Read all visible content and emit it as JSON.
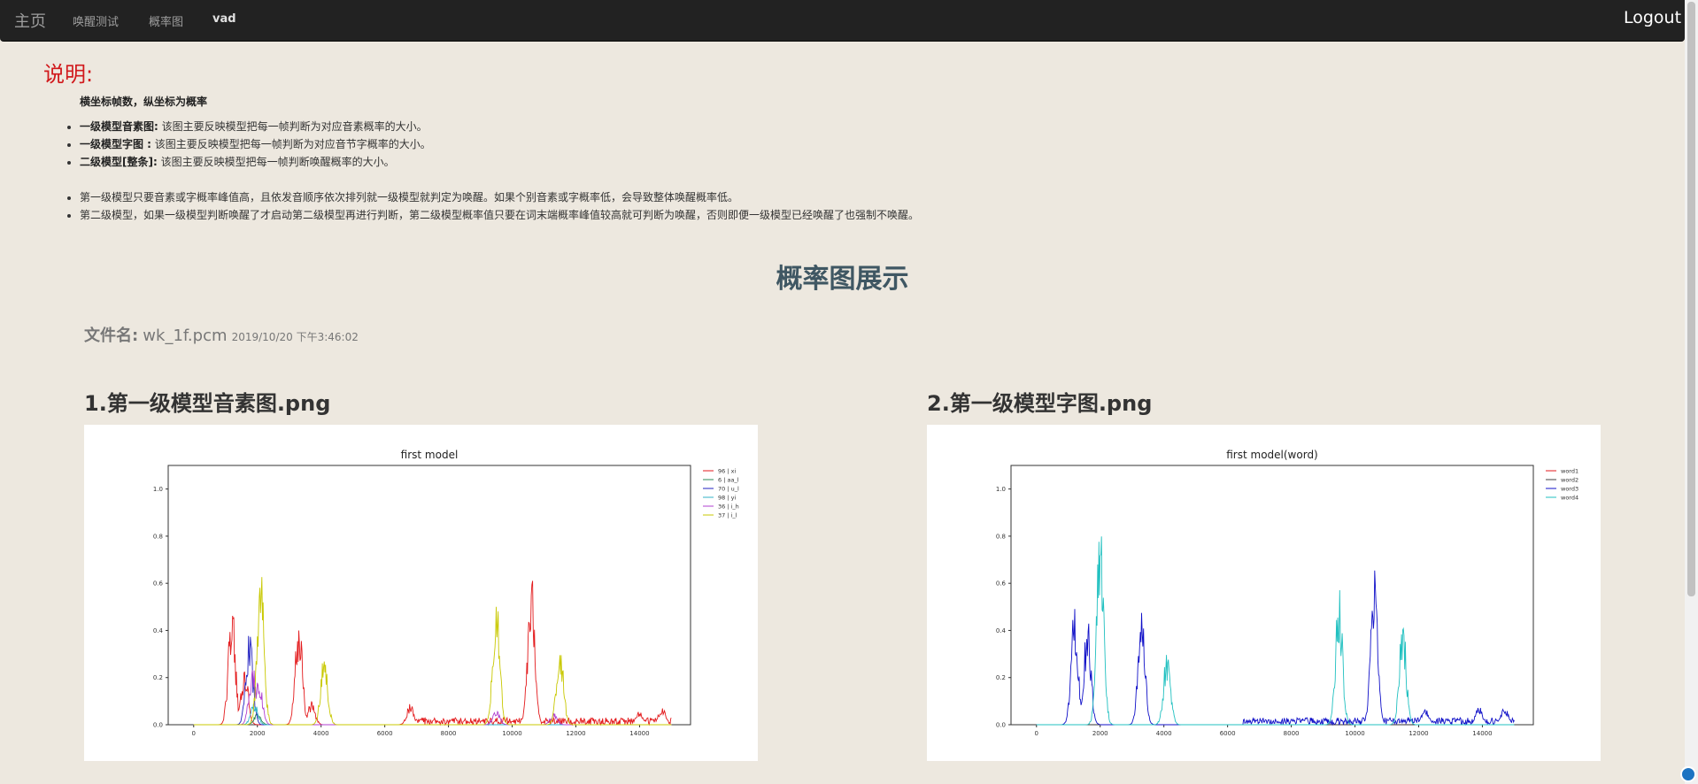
{
  "nav": {
    "brand": "主页",
    "items": [
      "唤醒测试",
      "概率图",
      "vad"
    ],
    "logout": "Logout"
  },
  "notes": {
    "title": "说明:",
    "axis_note": "横坐标帧数，纵坐标为概率",
    "items": [
      {
        "bold": "一级模型音素图:",
        "text": " 该图主要反映模型把每一帧判断为对应音素概率的大小。"
      },
      {
        "bold": "一级模型字图 :",
        "text": " 该图主要反映模型把每一帧判断为对应音节字概率的大小。"
      },
      {
        "bold": "二级模型[整条]:",
        "text": " 该图主要反映模型把每一帧判断唤醒概率的大小。"
      },
      {
        "bold": "",
        "text": "第一级模型只要音素或字概率峰值高，且依发音顺序依次排列就一级模型就判定为唤醒。如果个别音素或字概率低，会导致整体唤醒概率低。"
      },
      {
        "bold": "",
        "text": "第二级模型，如果一级模型判断唤醒了才启动第二级模型再进行判断，第二级模型概率值只要在词末端概率峰值较高就可判断为唤醒，否则即便一级模型已经唤醒了也强制不唤醒。"
      }
    ]
  },
  "section_title": "概率图展示",
  "file": {
    "label": "文件名:",
    "name": "wk_1f.pcm",
    "time": "2019/10/20 下午3:46:02"
  },
  "charts": {
    "c1_heading": "1.第一级模型音素图.png",
    "c2_heading": "2.第一级模型字图.png"
  },
  "chart_data": [
    {
      "type": "line",
      "title": "first model",
      "xlabel": "",
      "ylabel": "",
      "xlim": [
        -800,
        15600
      ],
      "ylim": [
        0,
        1.1
      ],
      "x_ticks": [
        "0",
        "2000",
        "4000",
        "6000",
        "8000",
        "10000",
        "12000",
        "14000"
      ],
      "y_ticks": [
        "0.0",
        "0.2",
        "0.4",
        "0.6",
        "0.8",
        "1.0"
      ],
      "legend_position": "top-right",
      "series": [
        {
          "name": "96 | xi",
          "color": "#e31a1c",
          "peaks": [
            [
              1200,
              0.54
            ],
            [
              1600,
              0.26
            ],
            [
              3300,
              0.49
            ],
            [
              3700,
              0.1
            ],
            [
              6800,
              0.09
            ],
            [
              10600,
              0.67
            ],
            [
              14000,
              0.06
            ],
            [
              14700,
              0.08
            ]
          ],
          "noise": 0.03,
          "noise_range": [
            7000,
            15000
          ]
        },
        {
          "name": "6 | aa_l",
          "color": "#2e8b57",
          "peaks": [
            [
              2000,
              0.05
            ]
          ]
        },
        {
          "name": "70 | u_l",
          "color": "#2020c0",
          "peaks": [
            [
              1750,
              0.4
            ]
          ]
        },
        {
          "name": "98 | yi",
          "color": "#33b3c7",
          "peaks": [
            [
              1900,
              0.1
            ]
          ]
        },
        {
          "name": "36 | i_h",
          "color": "#b040d0",
          "peaks": [
            [
              1850,
              0.26
            ],
            [
              2050,
              0.2
            ],
            [
              9500,
              0.06
            ],
            [
              11300,
              0.05
            ]
          ]
        },
        {
          "name": "37 | i_l",
          "color": "#c8c800",
          "peaks": [
            [
              2100,
              0.69
            ],
            [
              4100,
              0.32
            ],
            [
              9500,
              0.58
            ],
            [
              11500,
              0.36
            ]
          ]
        }
      ]
    },
    {
      "type": "line",
      "title": "first model(word)",
      "xlabel": "",
      "ylabel": "",
      "xlim": [
        -800,
        15600
      ],
      "ylim": [
        0,
        1.1
      ],
      "x_ticks": [
        "0",
        "2000",
        "4000",
        "6000",
        "8000",
        "10000",
        "12000",
        "14000"
      ],
      "y_ticks": [
        "0.0",
        "0.2",
        "0.4",
        "0.6",
        "0.8",
        "1.0"
      ],
      "legend_position": "top-right",
      "series": [
        {
          "name": "word1",
          "color": "#e31a1c",
          "peaks": []
        },
        {
          "name": "word2",
          "color": "#404040",
          "peaks": []
        },
        {
          "name": "word3",
          "color": "#1010c8",
          "peaks": [
            [
              1200,
              0.54
            ],
            [
              1600,
              0.47
            ],
            [
              3300,
              0.49
            ],
            [
              10600,
              0.67
            ],
            [
              12200,
              0.08
            ],
            [
              13900,
              0.08
            ],
            [
              14700,
              0.08
            ]
          ],
          "noise": 0.03,
          "noise_range": [
            6500,
            15000
          ]
        },
        {
          "name": "word4",
          "color": "#20c0c0",
          "peaks": [
            [
              2000,
              0.91
            ],
            [
              4100,
              0.33
            ],
            [
              9500,
              0.59
            ],
            [
              11500,
              0.46
            ]
          ]
        }
      ]
    }
  ]
}
